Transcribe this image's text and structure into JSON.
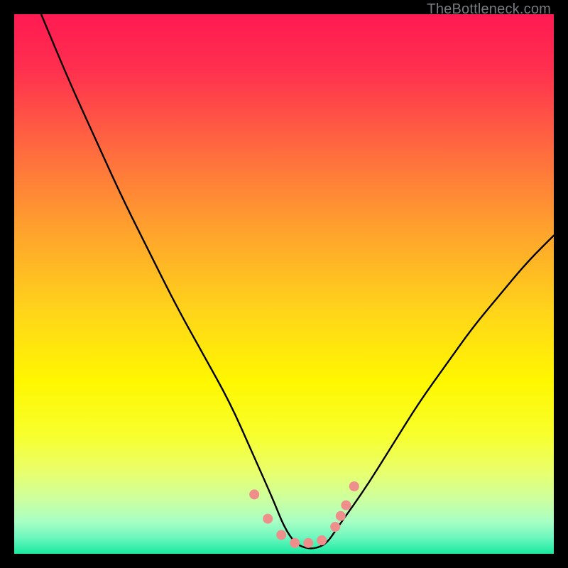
{
  "watermark": "TheBottleneck.com",
  "chart_data": {
    "type": "line",
    "title": "",
    "xlabel": "",
    "ylabel": "",
    "xlim": [
      0,
      100
    ],
    "ylim": [
      0,
      100
    ],
    "gradient_stops": [
      {
        "offset": 0.0,
        "color": "#ff1a52"
      },
      {
        "offset": 0.1,
        "color": "#ff2f4f"
      },
      {
        "offset": 0.25,
        "color": "#ff6a3f"
      },
      {
        "offset": 0.4,
        "color": "#ffa22d"
      },
      {
        "offset": 0.55,
        "color": "#ffd41a"
      },
      {
        "offset": 0.68,
        "color": "#fff700"
      },
      {
        "offset": 0.78,
        "color": "#f8ff2d"
      },
      {
        "offset": 0.85,
        "color": "#e8ff6e"
      },
      {
        "offset": 0.9,
        "color": "#ccffa0"
      },
      {
        "offset": 0.94,
        "color": "#a8ffc4"
      },
      {
        "offset": 0.97,
        "color": "#6cf7be"
      },
      {
        "offset": 1.0,
        "color": "#19e9a0"
      }
    ],
    "series": [
      {
        "name": "bottleneck-curve",
        "color": "#000000",
        "x": [
          5,
          10,
          15,
          20,
          25,
          30,
          35,
          40,
          44,
          48,
          50,
          52,
          54,
          56,
          58,
          60,
          65,
          70,
          75,
          80,
          85,
          90,
          95,
          100
        ],
        "y": [
          100,
          88,
          77,
          66,
          56,
          46,
          37,
          28,
          19,
          10,
          5,
          2,
          1,
          1,
          2,
          5,
          12,
          20,
          28,
          35,
          42,
          48,
          54,
          59
        ]
      }
    ],
    "markers": {
      "name": "highlight-dots",
      "color": "#ef8f8b",
      "radius_px": 7,
      "x": [
        44.5,
        47.0,
        49.5,
        52.0,
        54.5,
        57.0,
        59.5,
        60.5,
        61.5,
        63.0
      ],
      "y": [
        11.0,
        6.5,
        3.5,
        2.0,
        2.0,
        2.5,
        5.0,
        7.0,
        9.0,
        12.5
      ]
    }
  }
}
